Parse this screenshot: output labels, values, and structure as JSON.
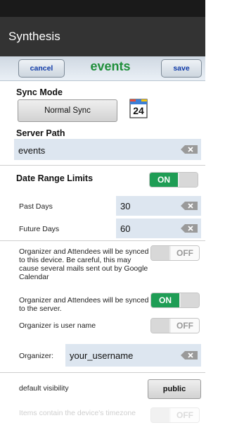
{
  "app": {
    "title": "Synthesis"
  },
  "toolbar": {
    "cancel_label": "cancel",
    "title": "events",
    "save_label": "save"
  },
  "sync": {
    "mode_label": "Sync Mode",
    "mode_button": "Normal Sync",
    "calendar_day": "24"
  },
  "server": {
    "label": "Server Path",
    "value": "events"
  },
  "date_range": {
    "label": "Date Range Limits",
    "toggle": "ON",
    "past_label": "Past Days",
    "past_value": "30",
    "future_label": "Future Days",
    "future_value": "60"
  },
  "organizer": {
    "sync_device_text": "Organizer and Attendees will be synced to this device. Be careful, this may cause several mails sent out by Google Calendar",
    "sync_device_toggle": "OFF",
    "sync_server_text": "Organizer and Attendees will be synced to the server.",
    "sync_server_toggle": "ON",
    "is_username_text": "Organizer is user name",
    "is_username_toggle": "OFF",
    "field_label": "Organizer:",
    "field_value": "your_username"
  },
  "visibility": {
    "label": "default visibility",
    "button": "public"
  },
  "timezone": {
    "label": "Items contain the device's timezone",
    "toggle": "OFF"
  },
  "colors": {
    "accent_green": "#1f9d55",
    "toolbar_blue": "#0f3aa8",
    "appbar": "#333333"
  }
}
